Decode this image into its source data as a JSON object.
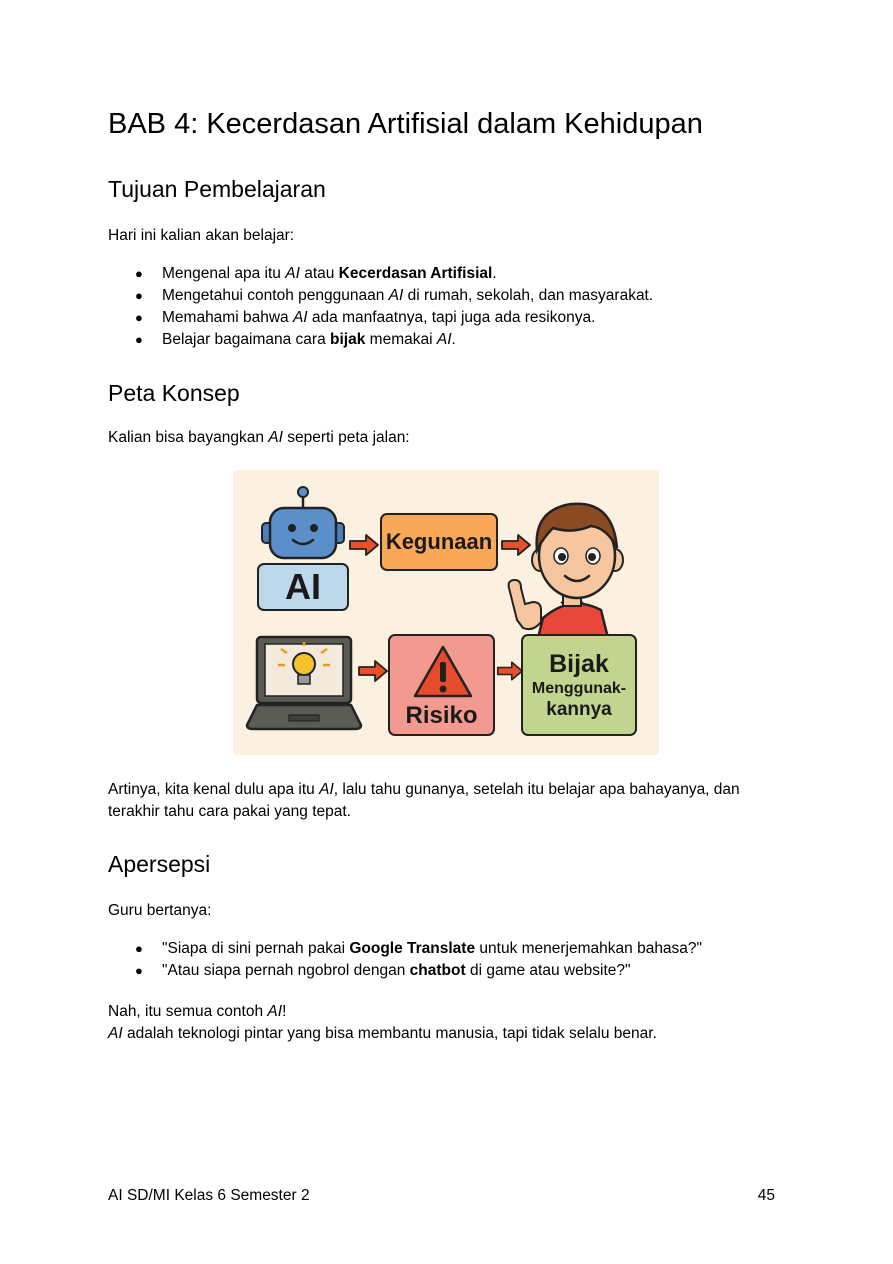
{
  "chapter": {
    "title": "BAB 4: Kecerdasan Artifisial dalam Kehidupan"
  },
  "tujuan": {
    "heading": "Tujuan Pembelajaran",
    "intro": "Hari ini kalian akan belajar:",
    "items": [
      {
        "a": "Mengenal apa itu ",
        "ai": "AI",
        "b": " atau ",
        "bold": "Kecerdasan Artifisial",
        "c": "."
      },
      {
        "a": "Mengetahui contoh penggunaan ",
        "ai": "AI",
        "b": " di rumah, sekolah, dan masyarakat."
      },
      {
        "a": "Memahami bahwa ",
        "ai": "AI",
        "b": " ada manfaatnya, tapi juga ada resikonya."
      },
      {
        "a": "Belajar bagaimana cara ",
        "bold": "bijak",
        "b": " memakai ",
        "ai": "AI",
        "c": "."
      }
    ]
  },
  "peta": {
    "heading": "Peta Konsep",
    "intro_a": "Kalian bisa bayangkan ",
    "intro_ai": "AI",
    "intro_b": " seperti peta jalan:",
    "diagram": {
      "box_ai": "AI",
      "box_kegunaan": "Kegunaan",
      "box_risiko": "Risiko",
      "box_bijak_1": "Bijak",
      "box_bijak_2": "Menggunak-",
      "box_bijak_3": "kannya",
      "colors": {
        "background": "#fcf1e0",
        "ai": "#bcd8ea",
        "kegunaan": "#f9a85a",
        "risiko": "#f29a90",
        "bijak": "#c2d58f",
        "arrow": "#e8502a"
      }
    },
    "caption_a": "Artinya, kita kenal dulu apa itu ",
    "caption_ai": "AI",
    "caption_b": ", lalu tahu gunanya, setelah itu belajar apa bahayanya, dan",
    "caption_c": "terakhir tahu cara pakai yang tepat."
  },
  "apersepsi": {
    "heading": "Apersepsi",
    "intro": "Guru bertanya:",
    "q1_a": "\"Siapa di sini pernah pakai ",
    "q1_bold": "Google Translate",
    "q1_b": " untuk menerjemahkan bahasa?\"",
    "q2_a": "\"Atau siapa pernah ngobrol dengan ",
    "q2_bold": "chatbot",
    "q2_b": " di game atau website?\"",
    "closing1_a": "Nah, itu semua contoh ",
    "closing1_ai": "AI",
    "closing1_b": "!",
    "closing2_ai": "AI",
    "closing2_b": " adalah teknologi pintar yang bisa membantu manusia, tapi tidak selalu benar."
  },
  "footer": {
    "left": "AI SD/MI Kelas 6 Semester 2",
    "page": "45"
  }
}
